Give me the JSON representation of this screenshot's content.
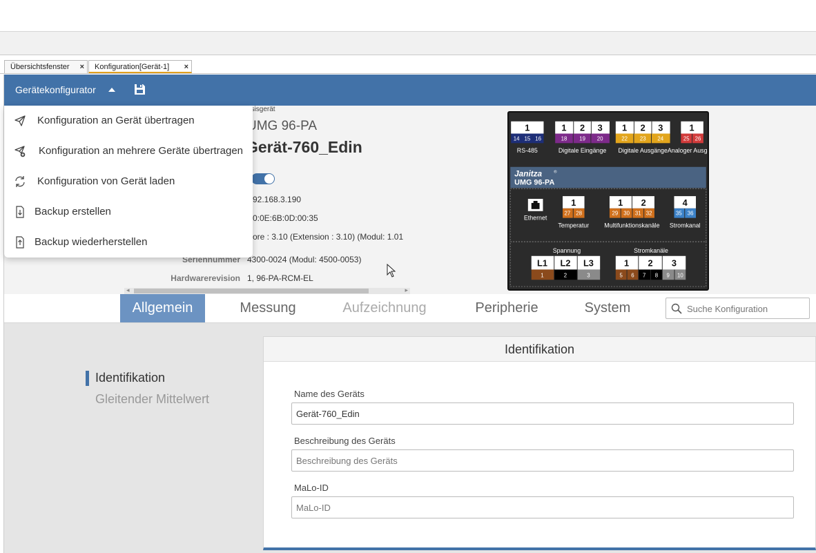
{
  "tabs": [
    {
      "label": "Übersichtsfenster",
      "close": "×"
    },
    {
      "label": "Konfiguration[Gerät-1]",
      "close": "×"
    }
  ],
  "appbar": {
    "title": "Gerätekonfigurator"
  },
  "menu": [
    {
      "label": "Konfiguration an Gerät übertragen",
      "icon": "send-icon"
    },
    {
      "label": "Konfiguration an mehrere Geräte übertragen",
      "icon": "send-multiple-icon"
    },
    {
      "label": "Konfiguration von Gerät laden",
      "icon": "reload-icon"
    },
    {
      "label": "Backup erstellen",
      "icon": "backup-create-icon"
    },
    {
      "label": "Backup wiederherstellen",
      "icon": "backup-restore-icon"
    }
  ],
  "device": {
    "base_fragment": "asisgerät",
    "model": "UMG 96-PA",
    "name": "Gerät-760_Edin",
    "ip": "92.168.3.190",
    "mac": "0:0E:6B:0D:00:35",
    "firmware": "ore : 3.10 (Extension : 3.10) (Modul: 1.01",
    "serial_label": "Seriennummer",
    "serial": "4300-0024 (Modul: 4500-0053)",
    "hw_label": "Hardwarerevision",
    "hw": "1, 96-PA-RCM-EL"
  },
  "panel": {
    "brand": "Janitza",
    "brand_mark": "®",
    "model": "UMG 96-PA",
    "top_groups": [
      {
        "label": "RS-485",
        "nums": [
          "1"
        ],
        "pins": [
          "14",
          "15",
          "16"
        ],
        "color": "#1d2e78"
      },
      {
        "label": "Digitale Eingänge",
        "nums": [
          "1",
          "2",
          "3"
        ],
        "pins": [
          "18",
          "19",
          "20"
        ],
        "color": "#7d2a8a"
      },
      {
        "label": "Digitale Ausgänge",
        "nums": [
          "1",
          "2",
          "3"
        ],
        "pins": [
          "22",
          "23",
          "24"
        ],
        "color": "#e2a51c"
      },
      {
        "label": "Analoger Ausgang",
        "nums": [
          "1"
        ],
        "pins": [
          "25",
          "26"
        ],
        "color": "#d23b3b"
      }
    ],
    "mid_groups": [
      {
        "label": "Ethernet"
      },
      {
        "label": "Temperatur",
        "nums": [
          "1"
        ],
        "pins": [
          "27",
          "28"
        ],
        "color": "#d0701c"
      },
      {
        "label": "Multifunktionskanäle",
        "nums": [
          "1",
          "2"
        ],
        "pins": [
          "29",
          "30",
          "31",
          "32"
        ],
        "color": "#d0701c"
      },
      {
        "label": "Stromkanal",
        "nums": [
          "4"
        ],
        "pins": [
          "35",
          "36"
        ],
        "color": "#3c82c8"
      }
    ],
    "voltage": {
      "label": "Spannung",
      "nums": [
        "L1",
        "L2",
        "L3"
      ],
      "pins": [
        "1",
        "2",
        "3"
      ]
    },
    "current": {
      "label": "Stromkanäle",
      "nums": [
        "1",
        "2",
        "3"
      ],
      "pins": [
        "5",
        "6",
        "7",
        "8",
        "9",
        "10"
      ]
    }
  },
  "nav": {
    "tabs": [
      "Allgemein",
      "Messung",
      "Aufzeichnung",
      "Peripherie",
      "System"
    ],
    "search_placeholder": "Suche Konfiguration"
  },
  "sidebar": {
    "active": "Identifikation",
    "other": "Gleitender Mittelwert"
  },
  "card": {
    "title": "Identifikation",
    "fields": [
      {
        "label": "Name des Geräts",
        "value": "Gerät-760_Edin",
        "placeholder": ""
      },
      {
        "label": "Beschreibung des Geräts",
        "value": "",
        "placeholder": "Beschreibung des Geräts"
      },
      {
        "label": "MaLo-ID",
        "value": "",
        "placeholder": "MaLo-ID"
      }
    ]
  }
}
